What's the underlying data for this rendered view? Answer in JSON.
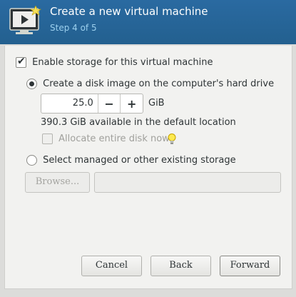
{
  "header": {
    "title": "Create a new virtual machine",
    "step": "Step 4 of 5",
    "icon": "new-vm-icon"
  },
  "storage": {
    "enable_label": "Enable storage for this virtual machine",
    "enable_checked": true,
    "create_disk_label": "Create a disk image on the computer's hard drive",
    "create_disk_selected": true,
    "disk_size": "25.0",
    "disk_unit": "GiB",
    "available_text": "390.3 GiB available in the default location",
    "allocate_label": "Allocate entire disk now",
    "allocate_checked": false,
    "select_existing_label": "Select managed or other existing storage",
    "select_existing_selected": false,
    "browse_label": "Browse...",
    "path_value": ""
  },
  "buttons": {
    "cancel": "Cancel",
    "back": "Back",
    "forward": "Forward"
  },
  "colors": {
    "header_bg": "#2a6aa1",
    "step_text": "#9cd0ee"
  }
}
